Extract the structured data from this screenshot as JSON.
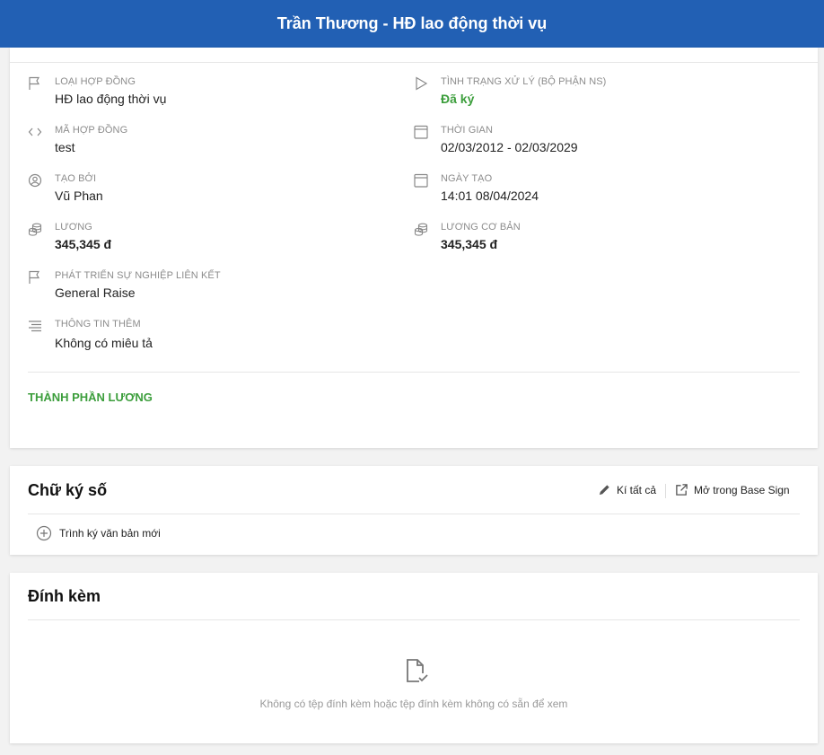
{
  "header": {
    "title": "Trần Thương - HĐ lao động thời vụ"
  },
  "fields": {
    "contract_type": {
      "label": "Loại hợp đồng",
      "value": "HĐ lao động thời vụ",
      "icon": "flag-icon"
    },
    "status": {
      "label": "Tình trạng xử lý (bộ phận NS)",
      "value": "Đã ký",
      "icon": "play-icon",
      "color": "#3c9e3c"
    },
    "contract_code": {
      "label": "Mã hợp đồng",
      "value": "test",
      "icon": "code-icon"
    },
    "period": {
      "label": "Thời gian",
      "value": "02/03/2012 - 02/03/2029",
      "icon": "calendar-icon"
    },
    "created_by": {
      "label": "Tạo bởi",
      "value": "Vũ Phan",
      "icon": "user-circle-icon"
    },
    "created_at": {
      "label": "Ngày tạo",
      "value": "14:01 08/04/2024",
      "icon": "calendar-icon"
    },
    "salary": {
      "label": "Lương",
      "value": "345,345 đ",
      "icon": "coins-icon"
    },
    "base_salary": {
      "label": "Lương cơ bản",
      "value": "345,345 đ",
      "icon": "coins-icon"
    },
    "career_link": {
      "label": "Phát triển sự nghiệp liên kết",
      "value": "General Raise",
      "icon": "flag-icon"
    },
    "extra_info": {
      "label": "Thông tin thêm",
      "value": "Không có miêu tả",
      "icon": "lines-icon"
    }
  },
  "salary_components": {
    "title": "Thành phần lương"
  },
  "signature": {
    "title": "Chữ ký số",
    "sign_all_label": "Kí tất cả",
    "open_base_sign_label": "Mở trong Base Sign",
    "new_document_label": "Trình ký văn bản mới"
  },
  "attachments": {
    "title": "Đính kèm",
    "empty_text": "Không có tệp đính kèm hoặc tệp đính kèm không có sẵn để xem"
  },
  "colors": {
    "header_bg": "#2260b4",
    "accent_green": "#3c9e3c"
  }
}
